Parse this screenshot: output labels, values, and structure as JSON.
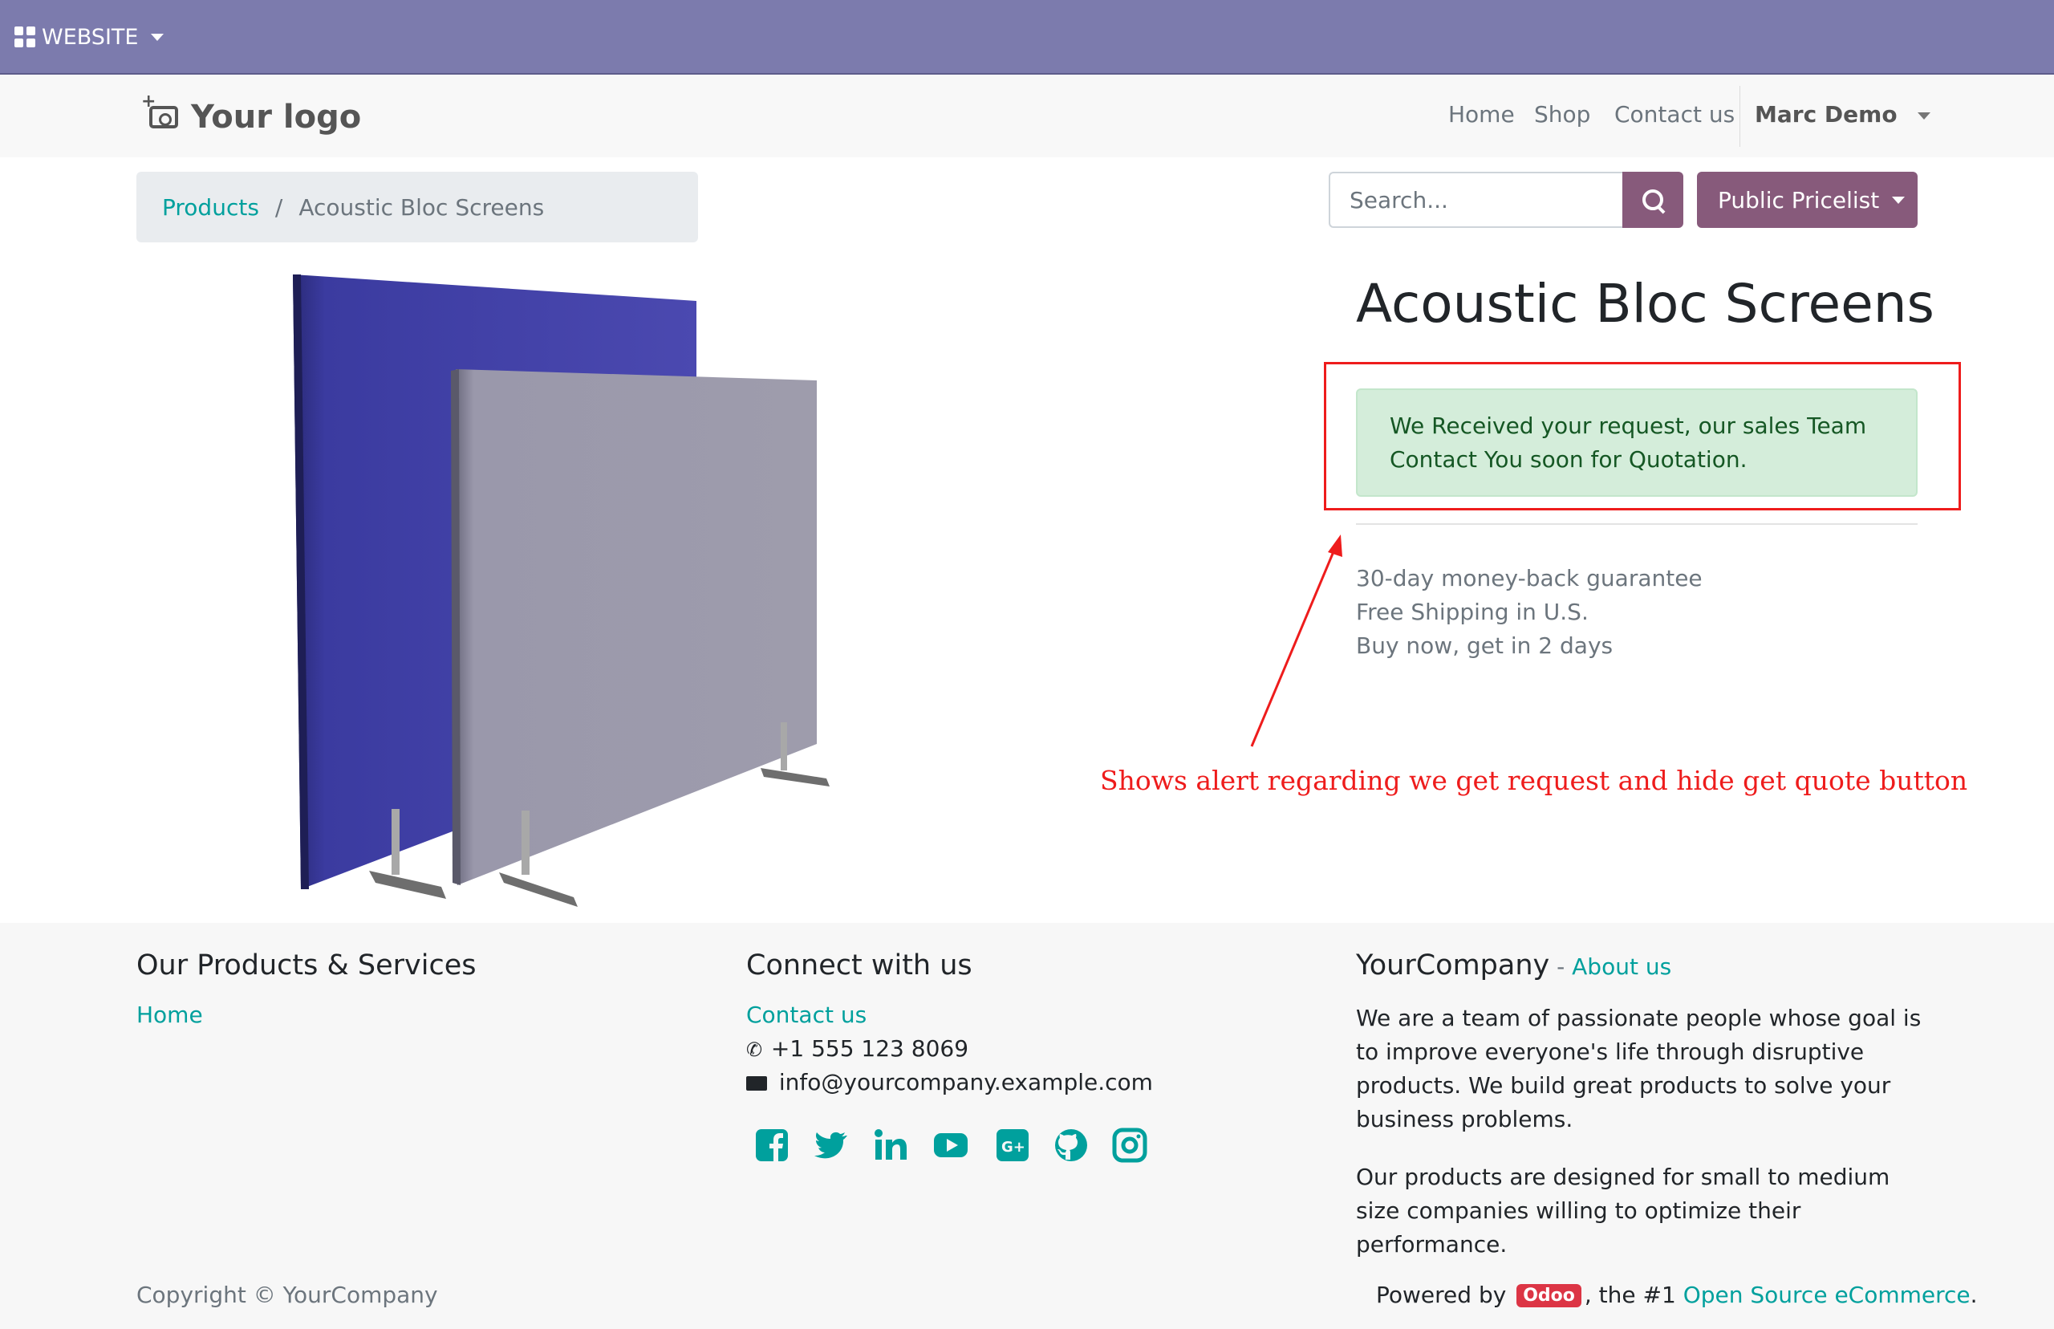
{
  "topbar": {
    "menu_label": "WEBSITE"
  },
  "header": {
    "logo_text": "Your logo",
    "nav": {
      "home": "Home",
      "shop": "Shop",
      "contact": "Contact us"
    },
    "user": "Marc Demo"
  },
  "breadcrumb": {
    "link": "Products",
    "separator": "/",
    "current": "Acoustic Bloc Screens"
  },
  "search": {
    "placeholder": "Search..."
  },
  "pricelist": {
    "label": "Public Pricelist"
  },
  "product": {
    "title": "Acoustic Bloc Screens",
    "alert": "We Received your request, our sales Team Contact You soon for Quotation.",
    "benefits": [
      "30-day money-back guarantee",
      "Free Shipping in U.S.",
      "Buy now, get in 2 days"
    ]
  },
  "annotation": {
    "text": "Shows alert regarding we get request and hide get quote button",
    "color": "#ee1c1c"
  },
  "footer": {
    "col1": {
      "heading": "Our Products & Services",
      "link": "Home"
    },
    "col2": {
      "heading": "Connect with us",
      "link": "Contact us",
      "phone": "+1 555 123 8069",
      "email": "info@yourcompany.example.com",
      "social_icons": [
        "facebook-icon",
        "twitter-icon",
        "linkedin-icon",
        "youtube-icon",
        "google-plus-icon",
        "github-icon",
        "instagram-icon"
      ]
    },
    "col3": {
      "company": "YourCompany",
      "dash": " - ",
      "about": "About us",
      "para1": "We are a team of passionate people whose goal is to improve everyone's life through disruptive products. We build great products to solve your business problems.",
      "para2": "Our products are designed for small to medium size companies willing to optimize their performance."
    },
    "copyright": "Copyright © YourCompany",
    "powered": {
      "prefix": "Powered by ",
      "badge": "Odoo",
      "middle": ", the #1 ",
      "link": "Open Source eCommerce",
      "suffix": "."
    }
  },
  "colors": {
    "topbar": "#7c7bad",
    "primary": "#875a7b",
    "link": "#00a09d",
    "alert_bg": "#d4edda",
    "alert_text": "#155724"
  }
}
